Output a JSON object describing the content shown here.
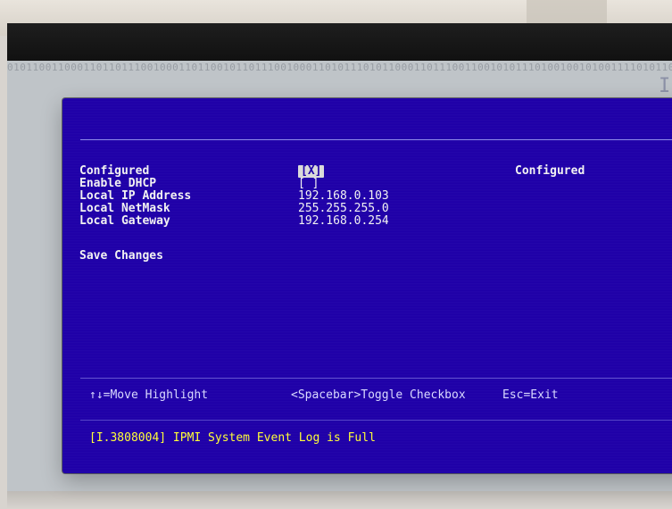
{
  "screen": {
    "corner_char": "I",
    "binary_noise": "0101100110001101101110010001101100101101110010001101011101011000110111001100101011101001001010011110101101100110101011101011010101100110101001101110110010101101001011010111011100101010011011010101101010010101110100101101011101101101101001010101011010110101010110110101011010101010110101101010110101011010101101101010101101011010110101010101101010110101101010101101011010101010110101011010101101010110101101010110101010110101011010101101010101101011010110101011010101101010110101"
  },
  "dialog": {
    "fields": [
      {
        "label": "Configured",
        "value": "[X]"
      },
      {
        "label": "Enable DHCP",
        "value": "[ ]"
      },
      {
        "label": "Local IP Address",
        "value": "192.168.0.103"
      },
      {
        "label": "Local NetMask",
        "value": "255.255.255.0"
      },
      {
        "label": "Local Gateway",
        "value": "192.168.0.254"
      }
    ],
    "status": "Configured",
    "save_changes": "Save Changes",
    "help": {
      "move": "↑↓=Move Highlight",
      "toggle": "<Spacebar>Toggle Checkbox",
      "exit": "Esc=Exit"
    },
    "log": "[I.3808004] IPMI System Event Log is Full"
  },
  "colors": {
    "dialog_background": "#1f00a8",
    "text": "#f2f2f2",
    "log_text": "#ffff38",
    "highlight": "#dadada"
  }
}
